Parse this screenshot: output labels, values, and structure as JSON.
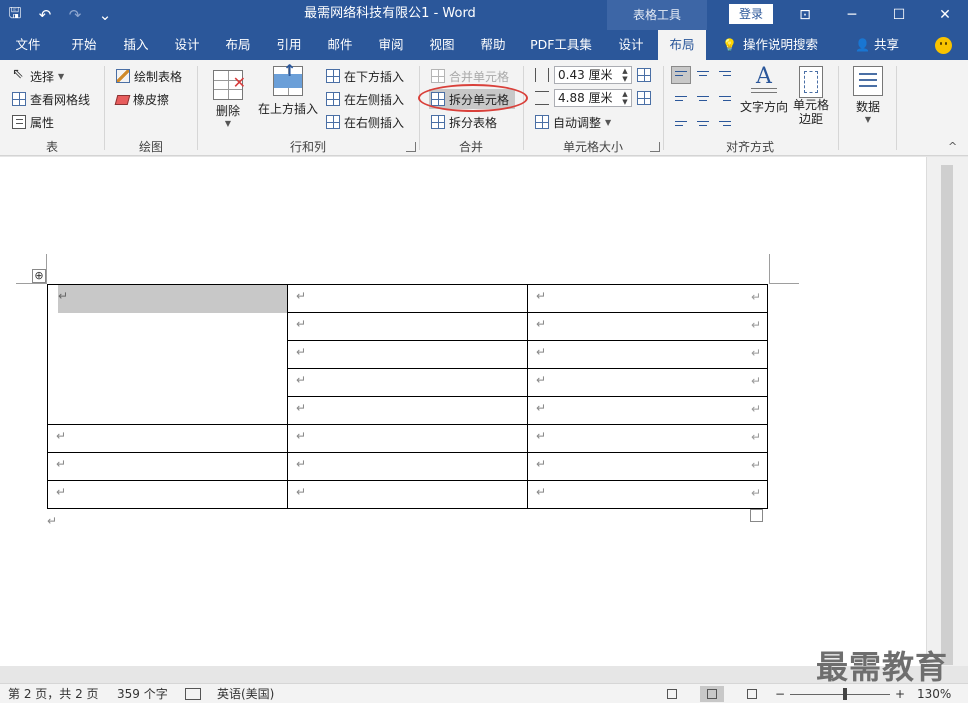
{
  "titlebar": {
    "doc_title": "最需网络科技有限公1  -  Word",
    "context_title": "表格工具",
    "login": "登录",
    "undo_glyph": "↶",
    "redo_glyph": "↷",
    "save_glyph": "🖫",
    "more_glyph": "⌄",
    "ribbon_opts_glyph": "⊡",
    "minimize_glyph": "─",
    "maximize_glyph": "☐",
    "close_glyph": "✕"
  },
  "tabs": {
    "file": "文件",
    "home": "开始",
    "insert": "插入",
    "design": "设计",
    "layout_doc": "布局",
    "references": "引用",
    "mailings": "邮件",
    "review": "审阅",
    "view": "视图",
    "help": "帮助",
    "pdf": "PDF工具集",
    "table_design": "设计",
    "table_layout": "布局",
    "tellme": "操作说明搜索",
    "share": "共享",
    "tellme_icon": "💡",
    "share_icon": "👤"
  },
  "ribbon": {
    "table_group": {
      "label": "表",
      "select": "选择",
      "gridlines": "查看网格线",
      "properties": "属性"
    },
    "draw_group": {
      "label": "绘图",
      "draw_table": "绘制表格",
      "eraser": "橡皮擦"
    },
    "rows_cols_group": {
      "label": "行和列",
      "delete": "删除",
      "insert_above": "在上方插入",
      "insert_below": "在下方插入",
      "insert_left": "在左侧插入",
      "insert_right": "在右侧插入"
    },
    "merge_group": {
      "label": "合并",
      "merge_cells": "合并单元格",
      "split_cells": "拆分单元格",
      "split_table": "拆分表格"
    },
    "cell_size_group": {
      "label": "单元格大小",
      "height": "0.43 厘米",
      "width": "4.88 厘米",
      "autofit": "自动调整"
    },
    "alignment_group": {
      "label": "对齐方式",
      "text_direction": "文字方向",
      "cell_margins_line1": "单元格",
      "cell_margins_line2": "边距"
    },
    "data_group": {
      "label": "数据"
    },
    "collapse_glyph": "^"
  },
  "document": {
    "para_mark": "↵",
    "move_handle_glyph": "⊕"
  },
  "watermark": "最需教育",
  "statusbar": {
    "page": "第 2 页，共 2 页",
    "words": "359 个字",
    "language": "英语(美国)",
    "zoom_minus": "−",
    "zoom_plus": "+",
    "zoom": "130%"
  },
  "colors": {
    "brand": "#2b579a",
    "highlight_ring": "#d9403a",
    "selection": "#c8c8c8"
  }
}
